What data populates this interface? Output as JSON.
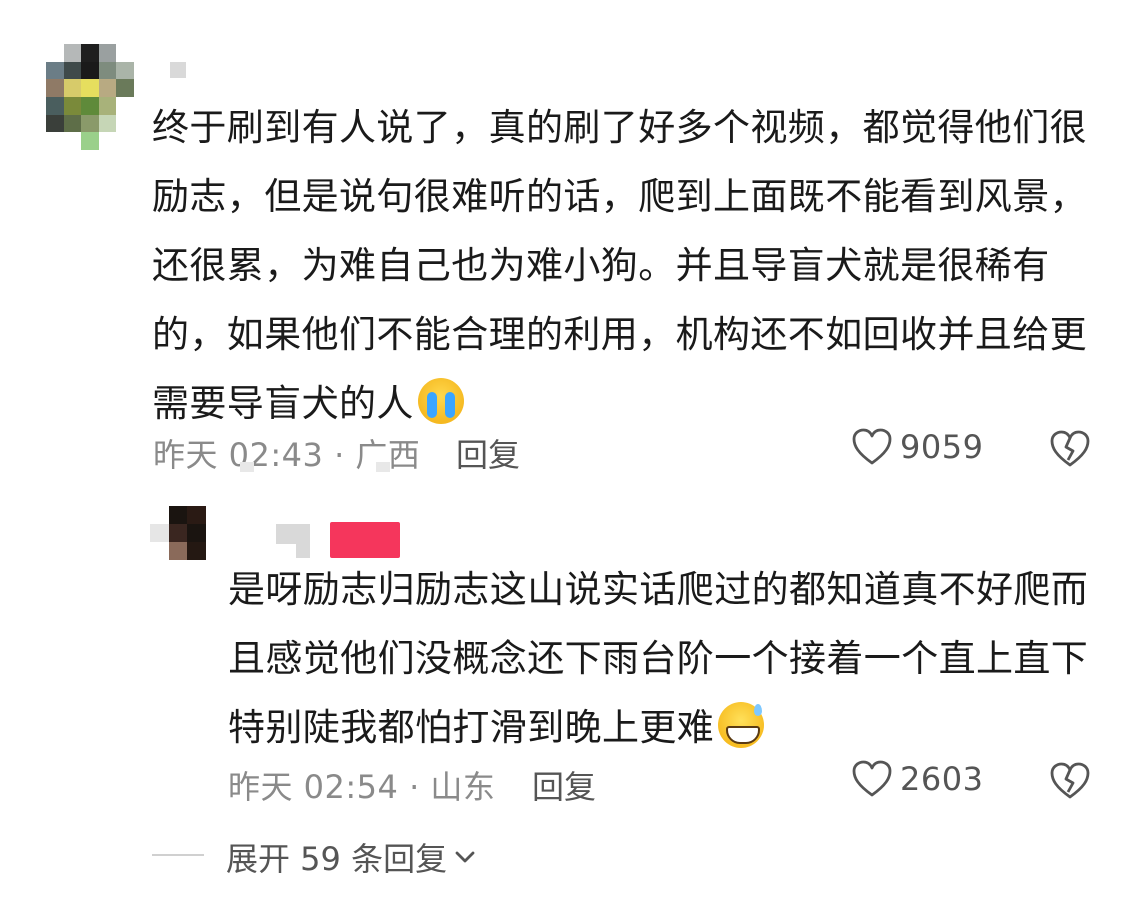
{
  "comments": [
    {
      "text": "终于刷到有人说了，真的刷了好多个视频，都觉得他们很励志，但是说句很难听的话，爬到上面既不能看到风景，还很累，为难自己也为难小狗。并且导盲犬就是很稀有的，如果他们不能合理的利用，机构还不如回收并且给更需要导盲犬的人",
      "emoji": "loudly-crying-face-emoji",
      "time_location": "昨天 02:43 · 广西",
      "reply_label": "回复",
      "like_count": "9059"
    },
    {
      "text": "是呀励志归励志这山说实话爬过的都知道真不好爬而且感觉他们没概念还下雨台阶一个接着一个直上直下特别陡我都怕打滑到晚上更难",
      "emoji": "grinning-sweat-face-emoji",
      "time_location": "昨天 02:54 · 山东",
      "reply_label": "回复",
      "like_count": "2603"
    }
  ],
  "expand_replies": {
    "label": "展开 59 条回复",
    "icon": "chevron-down-icon"
  },
  "colors": {
    "author_tag": "#f5365c",
    "meta_text": "#8a8a8a",
    "body_text": "#1a1a1a"
  }
}
